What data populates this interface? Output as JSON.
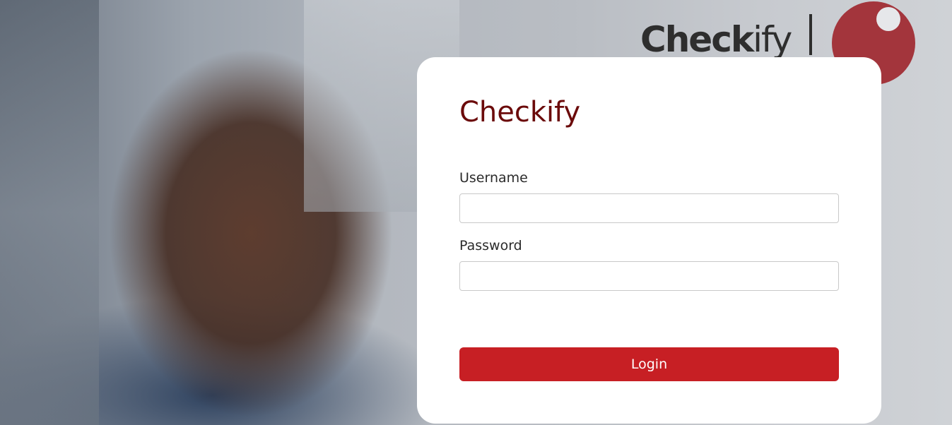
{
  "brand": {
    "logo_text_bold": "Check",
    "logo_text_light": "ify",
    "accent_color": "#a3353c"
  },
  "login": {
    "title": "Checkify",
    "title_color": "#6b0a0a",
    "username_label": "Username",
    "username_value": "",
    "password_label": "Password",
    "password_value": "",
    "submit_label": "Login",
    "submit_color": "#c71f24"
  }
}
